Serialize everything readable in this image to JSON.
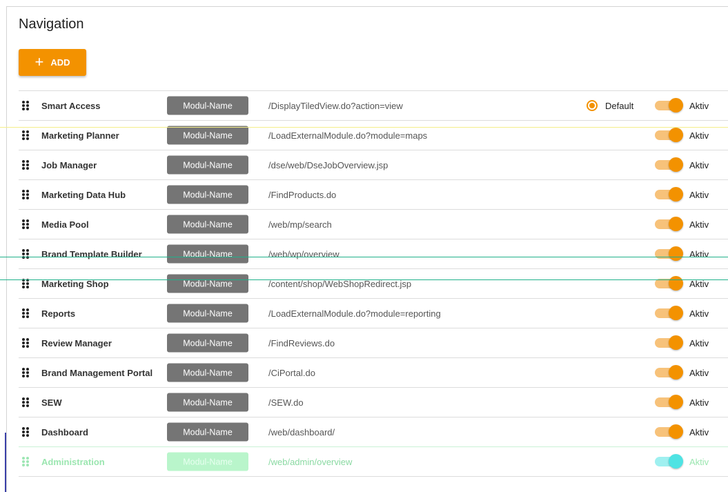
{
  "page": {
    "title": "Navigation",
    "add_label": "ADD",
    "add_icon": "plus-icon"
  },
  "colors": {
    "accent": "#f39200",
    "toggle_track": "#f7c27a",
    "module_chip": "#757575"
  },
  "rows": [
    {
      "name": "Smart Access",
      "module_label": "Modul-Name",
      "url": "/DisplayTiledView.do?action=view",
      "default_label": "Default",
      "is_default": true,
      "active_label": "Aktiv",
      "active": true
    },
    {
      "name": "Marketing Planner",
      "module_label": "Modul-Name",
      "url": "/LoadExternalModule.do?module=maps",
      "active_label": "Aktiv",
      "active": true
    },
    {
      "name": "Job Manager",
      "module_label": "Modul-Name",
      "url": "/dse/web/DseJobOverview.jsp",
      "active_label": "Aktiv",
      "active": true
    },
    {
      "name": "Marketing Data Hub",
      "module_label": "Modul-Name",
      "url": "/FindProducts.do",
      "active_label": "Aktiv",
      "active": true
    },
    {
      "name": "Media Pool",
      "module_label": "Modul-Name",
      "url": "/web/mp/search",
      "active_label": "Aktiv",
      "active": true
    },
    {
      "name": "Brand Template Builder",
      "module_label": "Modul-Name",
      "url": "/web/wp/overview",
      "active_label": "Aktiv",
      "active": true
    },
    {
      "name": "Marketing Shop",
      "module_label": "Modul-Name",
      "url": "/content/shop/WebShopRedirect.jsp",
      "active_label": "Aktiv",
      "active": true
    },
    {
      "name": "Reports",
      "module_label": "Modul-Name",
      "url": "/LoadExternalModule.do?module=reporting",
      "active_label": "Aktiv",
      "active": true
    },
    {
      "name": "Review Manager",
      "module_label": "Modul-Name",
      "url": "/FindReviews.do",
      "active_label": "Aktiv",
      "active": true
    },
    {
      "name": "Brand Management Portal",
      "module_label": "Modul-Name",
      "url": "/CiPortal.do",
      "active_label": "Aktiv",
      "active": true
    },
    {
      "name": "SEW",
      "module_label": "Modul-Name",
      "url": "/SEW.do",
      "active_label": "Aktiv",
      "active": true
    },
    {
      "name": "Dashboard",
      "module_label": "Modul-Name",
      "url": "/web/dashboard/",
      "active_label": "Aktiv",
      "active": true
    },
    {
      "name": "Administration",
      "module_label": "Modul-Name",
      "url": "/web/admin/overview",
      "active_label": "Aktiv",
      "active": true
    }
  ]
}
